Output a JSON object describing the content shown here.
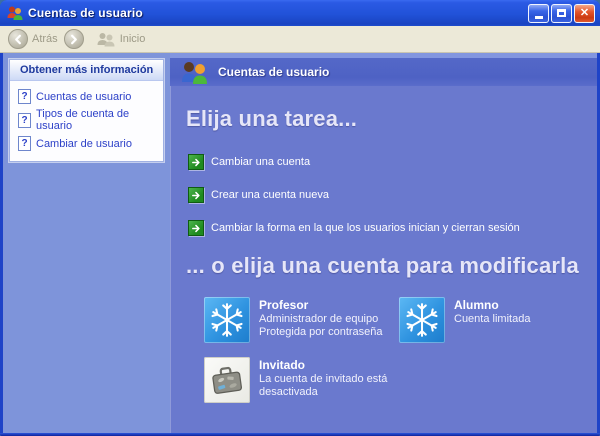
{
  "window": {
    "title": "Cuentas de usuario"
  },
  "toolbar": {
    "back_label": "Atrás",
    "home_label": "Inicio"
  },
  "sidebar": {
    "header": "Obtener más información",
    "links": [
      {
        "label": "Cuentas de usuario"
      },
      {
        "label": "Tipos de cuenta de usuario"
      },
      {
        "label": "Cambiar de usuario"
      }
    ]
  },
  "main": {
    "header_title": "Cuentas de usuario",
    "heading_tasks": "Elija una tarea...",
    "tasks": [
      {
        "label": "Cambiar una cuenta"
      },
      {
        "label": "Crear una cuenta nueva"
      },
      {
        "label": "Cambiar la forma en la que los usuarios inician y cierran sesión"
      }
    ],
    "heading_accounts": "... o elija una cuenta para modificarla",
    "accounts": [
      {
        "name": "Profesor",
        "lines": [
          "Administrador de equipo",
          "Protegida por contraseña"
        ],
        "icon": "snowflake"
      },
      {
        "name": "Alumno",
        "lines": [
          "Cuenta limitada"
        ],
        "icon": "snowflake"
      },
      {
        "name": "Invitado",
        "lines": [
          "La cuenta de invitado está desactivada"
        ],
        "icon": "suitcase"
      }
    ]
  },
  "icons": {
    "window_icon": "two-users",
    "back": "arrow-left-circle",
    "forward": "arrow-right-circle",
    "home": "two-users",
    "help_link": "help-document",
    "task_bullet": "green-arrow-square",
    "snowflake": "snowflake",
    "suitcase": "suitcase"
  },
  "colors": {
    "titlebar_blue": "#2152d8",
    "window_border": "#1e43c8",
    "sidebar_bg": "#7e94da",
    "main_bg": "#6a79ce",
    "band_bg": "#5063c6",
    "toolbar_bg": "#ece9d8",
    "link_blue": "#2d41c8",
    "task_green": "#1e8a1e",
    "snow_tile_blue": "#2f93e0",
    "close_red": "#e4552c"
  }
}
